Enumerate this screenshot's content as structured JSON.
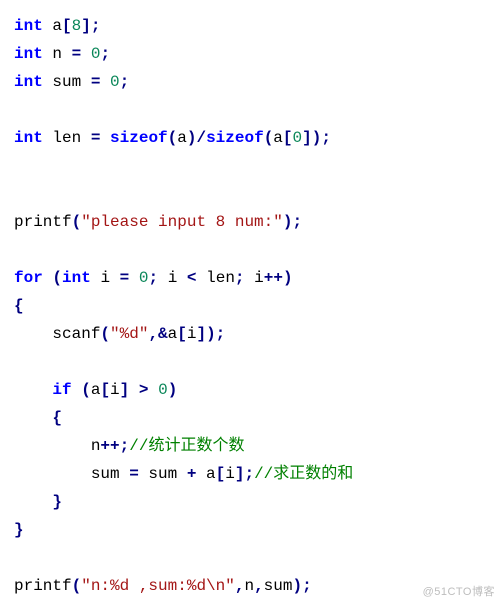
{
  "code": {
    "l1": {
      "kw1": "int",
      "t1": " a",
      "op1": "[",
      "n1": "8",
      "op2": "];"
    },
    "l2": {
      "kw1": "int",
      "t1": " n ",
      "op1": "=",
      "t2": " ",
      "n1": "0",
      "op2": ";"
    },
    "l3": {
      "kw1": "int",
      "t1": " sum ",
      "op1": "=",
      "t2": " ",
      "n1": "0",
      "op2": ";"
    },
    "l5": {
      "kw1": "int",
      "t1": " len ",
      "op1": "=",
      "t2": " ",
      "kw2": "sizeof",
      "op2": "(",
      "t3": "a",
      "op3": ")/",
      "kw3": "sizeof",
      "op4": "(",
      "t4": "a",
      "op5": "[",
      "n1": "0",
      "op6": "]);"
    },
    "l8": {
      "t1": "printf",
      "op1": "(",
      "s1": "\"please input 8 num:\"",
      "op2": ");"
    },
    "l10": {
      "kw1": "for",
      "t1": " ",
      "op1": "(",
      "kw2": "int",
      "t2": " i ",
      "op2": "=",
      "t3": " ",
      "n1": "0",
      "op3": ";",
      "t4": " i ",
      "op4": "<",
      "t5": " len",
      "op5": ";",
      "t6": " i",
      "op6": "++)"
    },
    "l11": {
      "op1": "{"
    },
    "l12": {
      "t1": "    scanf",
      "op1": "(",
      "s1": "\"%d\"",
      "op2": ",&",
      "t2": "a",
      "op3": "[",
      "t3": "i",
      "op4": "]);"
    },
    "l14": {
      "t1": "    ",
      "kw1": "if",
      "t2": " ",
      "op1": "(",
      "t3": "a",
      "op2": "[",
      "t4": "i",
      "op3": "]",
      "t5": " ",
      "op4": ">",
      "t6": " ",
      "n1": "0",
      "op5": ")"
    },
    "l15": {
      "t1": "    ",
      "op1": "{"
    },
    "l16": {
      "t1": "        n",
      "op1": "++;",
      "c1": "//统计正数个数"
    },
    "l17": {
      "t1": "        sum ",
      "op1": "=",
      "t2": " sum ",
      "op2": "+",
      "t3": " a",
      "op3": "[",
      "t4": "i",
      "op4": "];",
      "c1": "//求正数的和"
    },
    "l18": {
      "t1": "    ",
      "op1": "}"
    },
    "l19": {
      "op1": "}"
    },
    "l21": {
      "t1": "printf",
      "op1": "(",
      "s1": "\"n:%d ,sum:%d\\n\"",
      "op2": ",",
      "t2": "n",
      "op3": ",",
      "t3": "sum",
      "op4": ");"
    }
  },
  "watermark": "@51CTO博客"
}
